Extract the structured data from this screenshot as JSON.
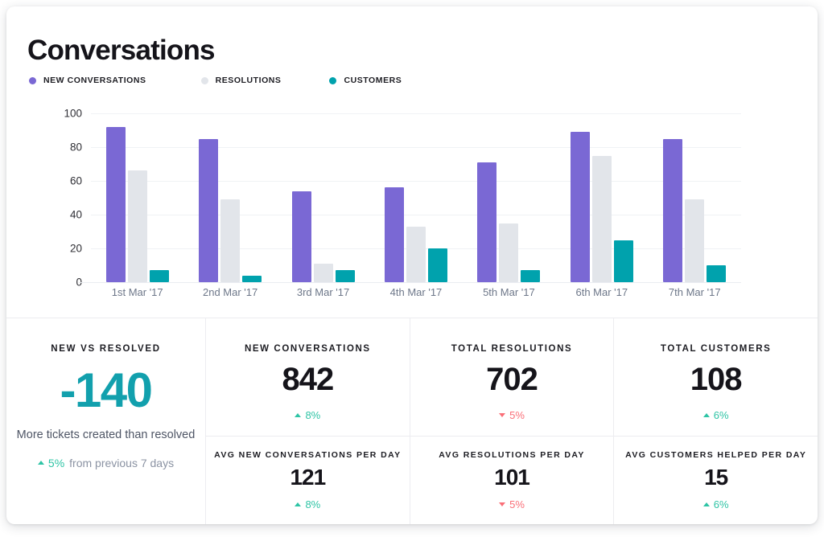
{
  "header": {
    "title": "Conversations"
  },
  "legend": [
    {
      "label": "NEW CONVERSATIONS",
      "color": "#7a68d4",
      "icon": "legend-dot-icon"
    },
    {
      "label": "RESOLUTIONS",
      "color": "#e2e5ea",
      "icon": "legend-dot-icon"
    },
    {
      "label": "CUSTOMERS",
      "color": "#00a2ad",
      "icon": "legend-dot-icon"
    }
  ],
  "chart_data": {
    "type": "bar",
    "title": "Conversations",
    "xlabel": "",
    "ylabel": "",
    "ylim": [
      0,
      100
    ],
    "yticks": [
      0,
      20,
      40,
      60,
      80,
      100
    ],
    "grid": true,
    "legend_position": "top-left",
    "categories": [
      "1st Mar '17",
      "2nd Mar '17",
      "3rd Mar '17",
      "4th Mar '17",
      "5th Mar '17",
      "6th Mar '17",
      "7th Mar '17"
    ],
    "series": [
      {
        "name": "NEW CONVERSATIONS",
        "color": "#7a68d4",
        "values": [
          92,
          85,
          54,
          56,
          71,
          89,
          85
        ]
      },
      {
        "name": "RESOLUTIONS",
        "color": "#e2e5ea",
        "values": [
          66,
          49,
          11,
          33,
          35,
          75,
          49
        ]
      },
      {
        "name": "CUSTOMERS",
        "color": "#00a2ad",
        "values": [
          7,
          4,
          7,
          20,
          7,
          25,
          10
        ]
      }
    ]
  },
  "stats": {
    "primary": {
      "label": "NEW VS RESOLVED",
      "value": "-140",
      "caption": "More tickets created than resolved",
      "delta": {
        "direction": "up",
        "pct": "5%",
        "since": "from previous 7 days"
      }
    },
    "top_row": [
      {
        "label": "NEW CONVERSATIONS",
        "value": "842",
        "delta": {
          "direction": "up",
          "pct": "8%"
        }
      },
      {
        "label": "TOTAL RESOLUTIONS",
        "value": "702",
        "delta": {
          "direction": "down",
          "pct": "5%"
        }
      },
      {
        "label": "TOTAL CUSTOMERS",
        "value": "108",
        "delta": {
          "direction": "up",
          "pct": "6%"
        }
      }
    ],
    "bottom_row": [
      {
        "label": "AVG NEW CONVERSATIONS PER DAY",
        "value": "121",
        "delta": {
          "direction": "up",
          "pct": "8%"
        }
      },
      {
        "label": "AVG RESOLUTIONS PER DAY",
        "value": "101",
        "delta": {
          "direction": "down",
          "pct": "5%"
        }
      },
      {
        "label": "AVG CUSTOMERS HELPED PER DAY",
        "value": "15",
        "delta": {
          "direction": "up",
          "pct": "6%"
        }
      }
    ]
  }
}
